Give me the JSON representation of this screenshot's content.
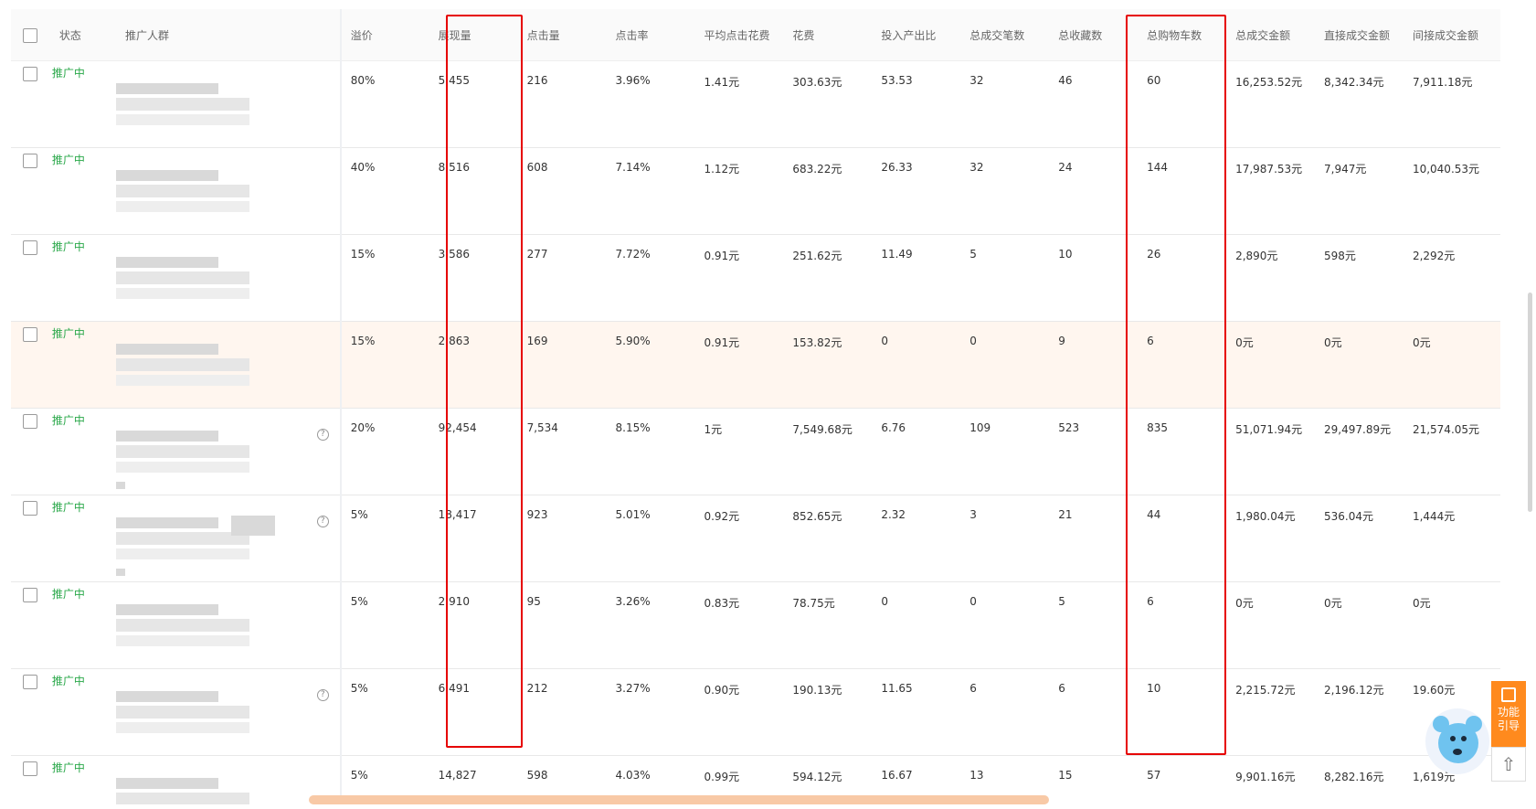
{
  "columns": [
    "状态",
    "推广人群",
    "溢价",
    "展现量",
    "点击量",
    "点击率",
    "平均点击花费",
    "花费",
    "投入产出比",
    "总成交笔数",
    "总收藏数",
    "总购物车数",
    "总成交金额",
    "直接成交金额",
    "间接成交金额"
  ],
  "rows": [
    {
      "status": "推广中",
      "premium": "80%",
      "impressions": "5,455",
      "clicks": "216",
      "ctr": "3.96%",
      "cpc": "1.41元",
      "spend": "303.63元",
      "roi": "53.53",
      "orders": "32",
      "favs": "46",
      "carts": "60",
      "total": "16,253.52元",
      "direct": "8,342.34元",
      "indirect": "7,911.18元"
    },
    {
      "status": "推广中",
      "premium": "40%",
      "impressions": "8,516",
      "clicks": "608",
      "ctr": "7.14%",
      "cpc": "1.12元",
      "spend": "683.22元",
      "roi": "26.33",
      "orders": "32",
      "favs": "24",
      "carts": "144",
      "total": "17,987.53元",
      "direct": "7,947元",
      "indirect": "10,040.53元"
    },
    {
      "status": "推广中",
      "premium": "15%",
      "impressions": "3,586",
      "clicks": "277",
      "ctr": "7.72%",
      "cpc": "0.91元",
      "spend": "251.62元",
      "roi": "11.49",
      "orders": "5",
      "favs": "10",
      "carts": "26",
      "total": "2,890元",
      "direct": "598元",
      "indirect": "2,292元"
    },
    {
      "status": "推广中",
      "premium": "15%",
      "impressions": "2,863",
      "clicks": "169",
      "ctr": "5.90%",
      "cpc": "0.91元",
      "spend": "153.82元",
      "roi": "0",
      "orders": "0",
      "favs": "9",
      "carts": "6",
      "total": "0元",
      "direct": "0元",
      "indirect": "0元"
    },
    {
      "status": "推广中",
      "premium": "20%",
      "impressions": "92,454",
      "clicks": "7,534",
      "ctr": "8.15%",
      "cpc": "1元",
      "spend": "7,549.68元",
      "roi": "6.76",
      "orders": "109",
      "favs": "523",
      "carts": "835",
      "total": "51,071.94元",
      "direct": "29,497.89元",
      "indirect": "21,574.05元"
    },
    {
      "status": "推广中",
      "premium": "5%",
      "impressions": "18,417",
      "clicks": "923",
      "ctr": "5.01%",
      "cpc": "0.92元",
      "spend": "852.65元",
      "roi": "2.32",
      "orders": "3",
      "favs": "21",
      "carts": "44",
      "total": "1,980.04元",
      "direct": "536.04元",
      "indirect": "1,444元"
    },
    {
      "status": "推广中",
      "premium": "5%",
      "impressions": "2,910",
      "clicks": "95",
      "ctr": "3.26%",
      "cpc": "0.83元",
      "spend": "78.75元",
      "roi": "0",
      "orders": "0",
      "favs": "5",
      "carts": "6",
      "total": "0元",
      "direct": "0元",
      "indirect": "0元"
    },
    {
      "status": "推广中",
      "premium": "5%",
      "impressions": "6,491",
      "clicks": "212",
      "ctr": "3.27%",
      "cpc": "0.90元",
      "spend": "190.13元",
      "roi": "11.65",
      "orders": "6",
      "favs": "6",
      "carts": "10",
      "total": "2,215.72元",
      "direct": "2,196.12元",
      "indirect": "19.60元"
    },
    {
      "status": "推广中",
      "premium": "5%",
      "impressions": "14,827",
      "clicks": "598",
      "ctr": "4.03%",
      "cpc": "0.99元",
      "spend": "594.12元",
      "roi": "16.67",
      "orders": "13",
      "favs": "15",
      "carts": "57",
      "total": "9,901.16元",
      "direct": "8,282.16元",
      "indirect": "1,619元"
    }
  ],
  "side_panel": {
    "guide_label_1": "功能",
    "guide_label_2": "引导",
    "top_icon": "arrow-up-icon",
    "guide_icon": "guide-icon"
  },
  "colors": {
    "status_active": "#2aa84a",
    "highlight_row": "#fff6ef",
    "annotation_box": "#e60000",
    "guide_button": "#ff8a1e",
    "scrollbar_thumb": "#f8c9a6"
  },
  "mascot": {
    "icon": "mouse-mascot-icon"
  }
}
